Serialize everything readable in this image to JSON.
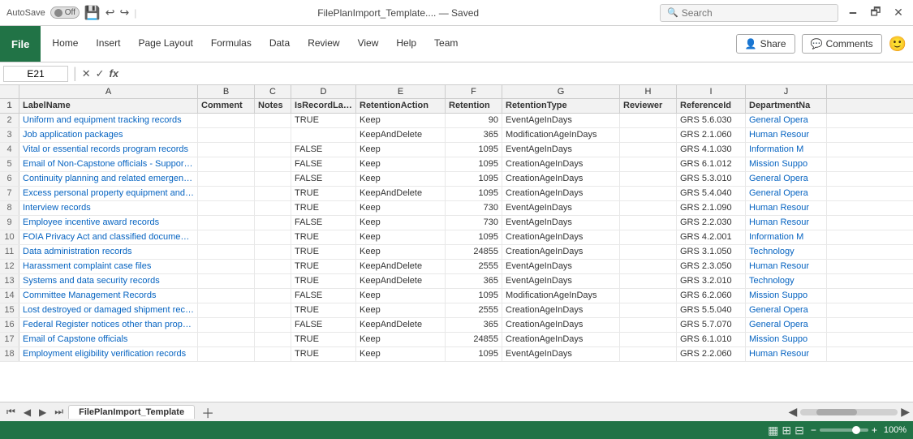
{
  "titleBar": {
    "autosave": "AutoSave",
    "autosave_state": "Off",
    "filename": "FilePlanImport_Template.... — Saved",
    "search_placeholder": "Search",
    "minimize": "🗕",
    "restore": "🗗",
    "close": "✕"
  },
  "ribbon": {
    "file_label": "File",
    "tabs": [
      "Home",
      "Insert",
      "Page Layout",
      "Formulas",
      "Data",
      "Review",
      "View",
      "Help",
      "Team"
    ],
    "share_label": "Share",
    "comments_label": "Comments"
  },
  "formulaBar": {
    "cell_ref": "E21",
    "fx_label": "fx"
  },
  "columns": {
    "headers": [
      "",
      "A",
      "B",
      "C",
      "D",
      "E",
      "F",
      "G",
      "H",
      "I",
      "J"
    ],
    "labels": [
      "LabelName",
      "Comment",
      "Notes",
      "IsRecordLabel",
      "RetentionAction",
      "Retention",
      "RetentionType",
      "Reviewer",
      "ReferenceId",
      "DepartmentNa"
    ]
  },
  "rows": [
    {
      "num": "2",
      "a": "Uniform and equipment tracking records",
      "b": "",
      "c": "",
      "d": "TRUE",
      "e": "Keep",
      "f": "90",
      "g": "EventAgeInDays",
      "h": "",
      "i": "GRS 5.6.030",
      "j": "General Opera"
    },
    {
      "num": "3",
      "a": "Job application packages",
      "b": "",
      "c": "",
      "d": "",
      "e": "KeepAndDelete",
      "f": "365",
      "g": "ModificationAgeInDays",
      "h": "",
      "i": "GRS 2.1.060",
      "j": "Human Resour"
    },
    {
      "num": "4",
      "a": "Vital or essential records program records",
      "b": "",
      "c": "",
      "d": "FALSE",
      "e": "Keep",
      "f": "1095",
      "g": "EventAgeInDays",
      "h": "",
      "i": "GRS 4.1.030",
      "j": "Information M"
    },
    {
      "num": "5",
      "a": "Email of Non-Capstone officials - Support and/or admin positions",
      "b": "",
      "c": "",
      "d": "FALSE",
      "e": "Keep",
      "f": "1095",
      "g": "CreationAgeInDays",
      "h": "",
      "i": "GRS 6.1.012",
      "j": "Mission Suppo"
    },
    {
      "num": "6",
      "a": "Continuity planning and related emergency planning files",
      "b": "",
      "c": "",
      "d": "FALSE",
      "e": "Keep",
      "f": "1095",
      "g": "CreationAgeInDays",
      "h": "",
      "i": "GRS 5.3.010",
      "j": "General Opera"
    },
    {
      "num": "7",
      "a": "Excess personal property equipment and vehicle records",
      "b": "",
      "c": "",
      "d": "TRUE",
      "e": "KeepAndDelete",
      "f": "1095",
      "g": "CreationAgeInDays",
      "h": "",
      "i": "GRS 5.4.040",
      "j": "General Opera"
    },
    {
      "num": "8",
      "a": "Interview records",
      "b": "",
      "c": "",
      "d": "TRUE",
      "e": "Keep",
      "f": "730",
      "g": "EventAgeInDays",
      "h": "",
      "i": "GRS 2.1.090",
      "j": "Human Resour"
    },
    {
      "num": "9",
      "a": "Employee incentive award records",
      "b": "",
      "c": "",
      "d": "FALSE",
      "e": "Keep",
      "f": "730",
      "g": "EventAgeInDays",
      "h": "",
      "i": "GRS 2.2.030",
      "j": "Human Resour"
    },
    {
      "num": "10",
      "a": "FOIA Privacy Act and classified documents admin records",
      "b": "",
      "c": "",
      "d": "TRUE",
      "e": "Keep",
      "f": "1095",
      "g": "CreationAgeInDays",
      "h": "",
      "i": "GRS 4.2.001",
      "j": "Information M"
    },
    {
      "num": "11",
      "a": "Data administration records",
      "b": "",
      "c": "",
      "d": "TRUE",
      "e": "Keep",
      "f": "24855",
      "g": "CreationAgeInDays",
      "h": "",
      "i": "GRS 3.1.050",
      "j": "Technology"
    },
    {
      "num": "12",
      "a": "Harassment complaint case files",
      "b": "",
      "c": "",
      "d": "TRUE",
      "e": "KeepAndDelete",
      "f": "2555",
      "g": "EventAgeInDays",
      "h": "",
      "i": "GRS 2.3.050",
      "j": "Human Resour"
    },
    {
      "num": "13",
      "a": "Systems and data security records",
      "b": "",
      "c": "",
      "d": "TRUE",
      "e": "KeepAndDelete",
      "f": "365",
      "g": "EventAgeInDays",
      "h": "",
      "i": "GRS 3.2.010",
      "j": "Technology"
    },
    {
      "num": "14",
      "a": "Committee Management Records",
      "b": "",
      "c": "",
      "d": "FALSE",
      "e": "Keep",
      "f": "1095",
      "g": "ModificationAgeInDays",
      "h": "",
      "i": "GRS 6.2.060",
      "j": "Mission Suppo"
    },
    {
      "num": "15",
      "a": "Lost destroyed or damaged shipment records",
      "b": "",
      "c": "",
      "d": "TRUE",
      "e": "Keep",
      "f": "2555",
      "g": "CreationAgeInDays",
      "h": "",
      "i": "GRS 5.5.040",
      "j": "General Opera"
    },
    {
      "num": "16",
      "a": "Federal Register notices other than proposed and final rules",
      "b": "",
      "c": "",
      "d": "FALSE",
      "e": "KeepAndDelete",
      "f": "365",
      "g": "CreationAgeInDays",
      "h": "",
      "i": "GRS 5.7.070",
      "j": "General Opera"
    },
    {
      "num": "17",
      "a": "Email of Capstone officials",
      "b": "",
      "c": "",
      "d": "TRUE",
      "e": "Keep",
      "f": "24855",
      "g": "CreationAgeInDays",
      "h": "",
      "i": "GRS 6.1.010",
      "j": "Mission Suppo"
    },
    {
      "num": "18",
      "a": "Employment eligibility verification records",
      "b": "",
      "c": "",
      "d": "TRUE",
      "e": "Keep",
      "f": "1095",
      "g": "EventAgeInDays",
      "h": "",
      "i": "GRS 2.2.060",
      "j": "Human Resour"
    }
  ],
  "sheetTab": {
    "name": "FilePlanImport_Template"
  },
  "statusBar": {
    "zoom": "100%"
  }
}
